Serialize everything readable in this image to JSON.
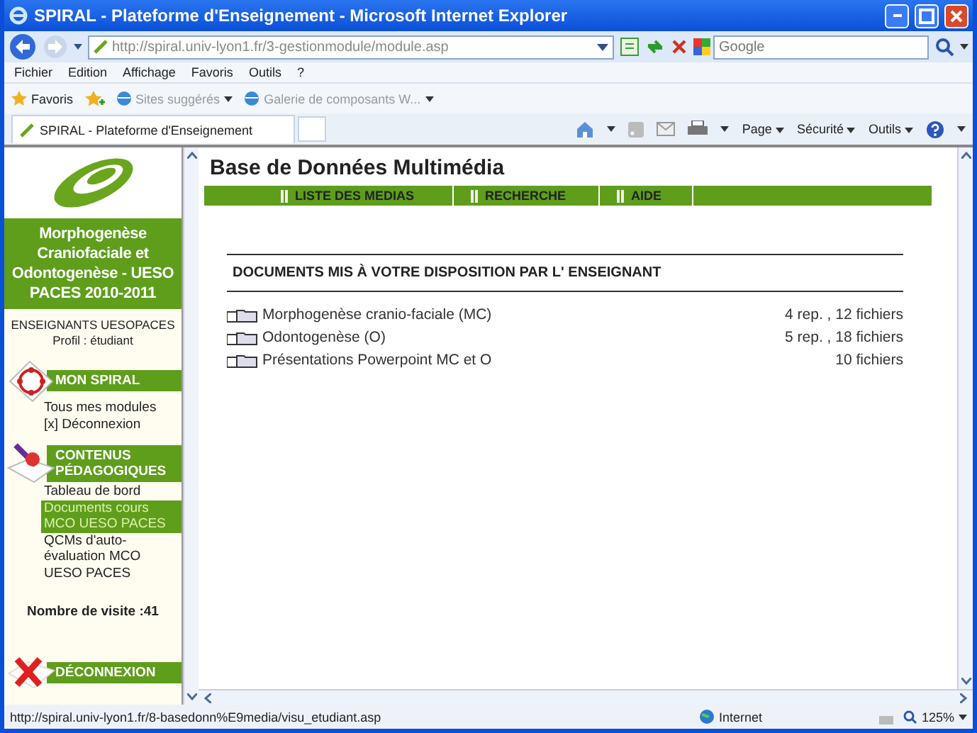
{
  "window": {
    "title": "SPIRAL - Plateforme d'Enseignement - Microsoft Internet Explorer"
  },
  "address_bar": {
    "value": "http://spiral.univ-lyon1.fr/3-gestionmodule/module.asp"
  },
  "search": {
    "placeholder": "Google"
  },
  "menu": [
    "Fichier",
    "Edition",
    "Affichage",
    "Favoris",
    "Outils",
    "?"
  ],
  "favorites_bar": [
    {
      "label": "Favoris",
      "kind": "favorites"
    },
    {
      "label": "Sites suggérés",
      "kind": "link"
    },
    {
      "label": "Galerie de composants W...",
      "kind": "link"
    }
  ],
  "tab": {
    "title": "SPIRAL - Plateforme d'Enseignement"
  },
  "command_bar": [
    "Page",
    "Sécurité",
    "Outils"
  ],
  "sidebar": {
    "course_title": "Morphogenèse Craniofaciale et Odontogenèse - UESO PACES 2010-2011",
    "user": "ENSEIGNANTS UESOPACES",
    "profile": "Profil : étudiant",
    "sections": [
      {
        "title": "MON SPIRAL",
        "kind": "spiral",
        "items": [
          {
            "label": "Tous mes modules",
            "selected": false
          },
          {
            "label": "[x]  Déconnexion",
            "selected": false
          }
        ]
      },
      {
        "title": "CONTENUS PÉDAGOGIQUES",
        "kind": "contents",
        "items": [
          {
            "label": "Tableau de bord",
            "selected": false
          },
          {
            "label": "Documents cours MCO UESO PACES",
            "selected": true
          },
          {
            "label": "QCMs d'auto-évaluation MCO UESO PACES",
            "selected": false
          }
        ]
      }
    ],
    "visits": "Nombre de visite :41",
    "logout": "DÉCONNEXION"
  },
  "main": {
    "title": "Base de Données Multimédia",
    "nav": [
      "LISTE DES MEDIAS",
      "RECHERCHE",
      "AIDE"
    ],
    "heading": "DOCUMENTS MIS À VOTRE DISPOSITION PAR L' ENSEIGNANT",
    "rows": [
      {
        "name": "Morphogenèse cranio-faciale (MC)",
        "count": "4 rep. , 12 fichiers"
      },
      {
        "name": "Odontogenèse (O)",
        "count": "5 rep. , 18 fichiers"
      },
      {
        "name": "Présentations Powerpoint MC et O",
        "count": "10 fichiers"
      }
    ]
  },
  "status_bar": {
    "url": "http://spiral.univ-lyon1.fr/8-basedonn%E9media/visu_etudiant.asp",
    "zone": "Internet",
    "zoom": "125%"
  }
}
